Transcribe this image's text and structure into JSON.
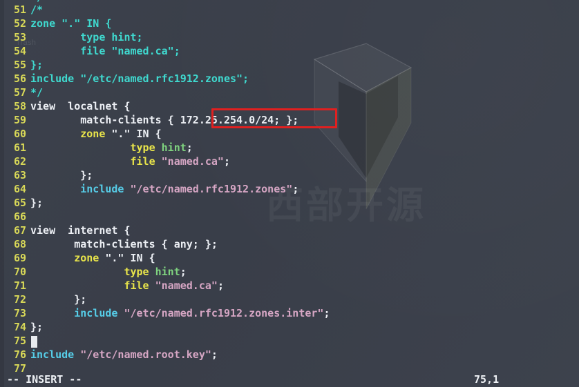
{
  "app": {
    "name": "vim",
    "background_color": "#3a3f4a"
  },
  "desktop": {
    "trash_label": "Trash"
  },
  "watermark": {
    "text": "西部开源",
    "logo_icon": "3d-arrow-logo-icon"
  },
  "editor": {
    "first_line_number": 51,
    "cursor_line": 75,
    "cursor_column": 1,
    "top_partial_line": "*/",
    "lines": [
      {
        "num": "51",
        "tokens": [
          {
            "t": "/*",
            "c": "c-comment"
          }
        ]
      },
      {
        "num": "52",
        "tokens": [
          {
            "t": "zone \".\" IN {",
            "c": "c-comment"
          }
        ]
      },
      {
        "num": "53",
        "tokens": [
          {
            "t": "        type hint;",
            "c": "c-comment"
          }
        ]
      },
      {
        "num": "54",
        "tokens": [
          {
            "t": "        file \"named.ca\";",
            "c": "c-comment"
          }
        ]
      },
      {
        "num": "55",
        "tokens": [
          {
            "t": "};",
            "c": "c-comment"
          }
        ]
      },
      {
        "num": "56",
        "tokens": [
          {
            "t": "include \"/etc/named.rfc1912.zones\";",
            "c": "c-comment"
          }
        ]
      },
      {
        "num": "57",
        "tokens": [
          {
            "t": "*/",
            "c": "c-comment"
          }
        ]
      },
      {
        "num": "58",
        "tokens": [
          {
            "t": "view  localnet {",
            "c": "c-plain"
          }
        ]
      },
      {
        "num": "59",
        "tokens": [
          {
            "t": "        match-clients { ",
            "c": "c-plain"
          },
          {
            "t": "172.25.254.0/24",
            "c": "c-plain"
          },
          {
            "t": "; };",
            "c": "c-plain"
          }
        ]
      },
      {
        "num": "60",
        "tokens": [
          {
            "t": "        ",
            "c": "c-plain"
          },
          {
            "t": "zone",
            "c": "c-kw"
          },
          {
            "t": " \".\" IN {",
            "c": "c-plain"
          }
        ]
      },
      {
        "num": "61",
        "tokens": [
          {
            "t": "                ",
            "c": "c-plain"
          },
          {
            "t": "type",
            "c": "c-kw"
          },
          {
            "t": " ",
            "c": "c-plain"
          },
          {
            "t": "hint",
            "c": "c-green"
          },
          {
            "t": ";",
            "c": "c-plain"
          }
        ]
      },
      {
        "num": "62",
        "tokens": [
          {
            "t": "                ",
            "c": "c-plain"
          },
          {
            "t": "file",
            "c": "c-kw"
          },
          {
            "t": " ",
            "c": "c-plain"
          },
          {
            "t": "\"named.ca\"",
            "c": "c-str"
          },
          {
            "t": ";",
            "c": "c-plain"
          }
        ]
      },
      {
        "num": "63",
        "tokens": [
          {
            "t": "        };",
            "c": "c-plain"
          }
        ]
      },
      {
        "num": "64",
        "tokens": [
          {
            "t": "        ",
            "c": "c-plain"
          },
          {
            "t": "include",
            "c": "c-inc"
          },
          {
            "t": " ",
            "c": "c-plain"
          },
          {
            "t": "\"/etc/named.rfc1912.zones\"",
            "c": "c-str"
          },
          {
            "t": ";",
            "c": "c-plain"
          }
        ]
      },
      {
        "num": "65",
        "tokens": [
          {
            "t": "};",
            "c": "c-plain"
          }
        ]
      },
      {
        "num": "66",
        "tokens": [
          {
            "t": "",
            "c": "c-plain"
          }
        ]
      },
      {
        "num": "67",
        "tokens": [
          {
            "t": "view  internet {",
            "c": "c-plain"
          }
        ]
      },
      {
        "num": "68",
        "tokens": [
          {
            "t": "       match-clients { any; };",
            "c": "c-plain"
          }
        ]
      },
      {
        "num": "69",
        "tokens": [
          {
            "t": "       ",
            "c": "c-plain"
          },
          {
            "t": "zone",
            "c": "c-kw"
          },
          {
            "t": " \".\" IN {",
            "c": "c-plain"
          }
        ]
      },
      {
        "num": "70",
        "tokens": [
          {
            "t": "               ",
            "c": "c-plain"
          },
          {
            "t": "type",
            "c": "c-kw"
          },
          {
            "t": " ",
            "c": "c-plain"
          },
          {
            "t": "hint",
            "c": "c-green"
          },
          {
            "t": ";",
            "c": "c-plain"
          }
        ]
      },
      {
        "num": "71",
        "tokens": [
          {
            "t": "               ",
            "c": "c-plain"
          },
          {
            "t": "file",
            "c": "c-kw"
          },
          {
            "t": " ",
            "c": "c-plain"
          },
          {
            "t": "\"named.ca\"",
            "c": "c-str"
          },
          {
            "t": ";",
            "c": "c-plain"
          }
        ]
      },
      {
        "num": "72",
        "tokens": [
          {
            "t": "       };",
            "c": "c-plain"
          }
        ]
      },
      {
        "num": "73",
        "tokens": [
          {
            "t": "       ",
            "c": "c-plain"
          },
          {
            "t": "include",
            "c": "c-inc"
          },
          {
            "t": " ",
            "c": "c-plain"
          },
          {
            "t": "\"/etc/named.rfc1912.zones.inter\"",
            "c": "c-str"
          },
          {
            "t": ";",
            "c": "c-plain"
          }
        ]
      },
      {
        "num": "74",
        "tokens": [
          {
            "t": "};",
            "c": "c-plain"
          }
        ]
      },
      {
        "num": "75",
        "tokens": [
          {
            "t": "",
            "c": "c-plain"
          }
        ]
      },
      {
        "num": "76",
        "tokens": [
          {
            "t": "",
            "c": "c-plain"
          },
          {
            "t": "include",
            "c": "c-inc"
          },
          {
            "t": " ",
            "c": "c-plain"
          },
          {
            "t": "\"/etc/named.root.key\"",
            "c": "c-str"
          },
          {
            "t": ";",
            "c": "c-plain"
          }
        ]
      },
      {
        "num": "77",
        "tokens": [
          {
            "t": "",
            "c": "c-plain"
          }
        ]
      }
    ]
  },
  "highlight": {
    "label": "172.25.254.0/24;",
    "color": "#e02020"
  },
  "statusbar": {
    "mode": "-- INSERT --",
    "position": "75,1"
  }
}
